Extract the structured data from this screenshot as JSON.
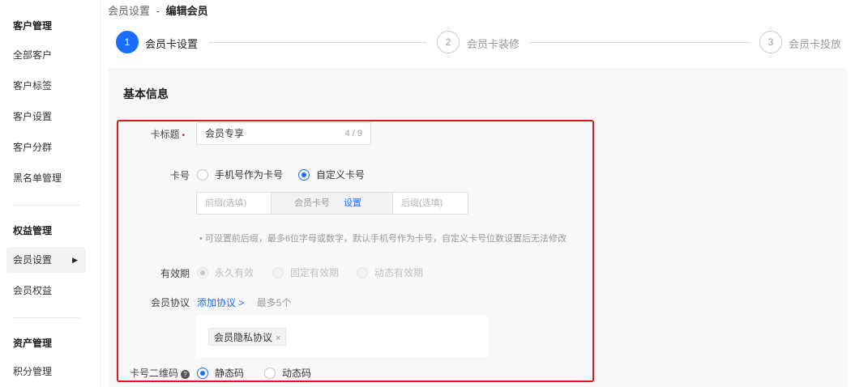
{
  "sidebar": {
    "groups": [
      {
        "title": "客户管理",
        "items": [
          "全部客户",
          "客户标签",
          "客户设置",
          "客户分群",
          "黑名单管理"
        ]
      },
      {
        "title": "权益管理",
        "items": [
          "会员设置",
          "会员权益"
        ]
      },
      {
        "title": "资产管理",
        "items": [
          "积分管理"
        ]
      }
    ],
    "active_item": "会员设置",
    "active_arrow": "▶"
  },
  "breadcrumb": {
    "parent": "会员设置",
    "separator": "-",
    "current": "编辑会员"
  },
  "steps": [
    {
      "num": "1",
      "label": "会员卡设置",
      "active": true
    },
    {
      "num": "2",
      "label": "会员卡装修",
      "active": false
    },
    {
      "num": "3",
      "label": "会员卡投放",
      "active": false
    }
  ],
  "section_title": "基本信息",
  "form": {
    "title_field": {
      "label": "卡标题",
      "required_mark": "•",
      "value": "会员专享",
      "counter": "4 / 9"
    },
    "card_no": {
      "label": "卡号",
      "options": [
        "手机号作为卡号",
        "自定义卡号"
      ],
      "selected": "自定义卡号",
      "prefix_placeholder": "前缀(选填)",
      "middle_label": "会员卡号",
      "middle_link": "设置",
      "suffix_placeholder": "后缀(选填)",
      "hint": "• 可设置前后缀，最多6位字母或数字，默认手机号作为卡号，自定义卡号位数设置后无法修改"
    },
    "validity": {
      "label": "有效期",
      "options": [
        "永久有效",
        "固定有效期",
        "动态有效期"
      ],
      "selected": "永久有效",
      "disabled": true
    },
    "agreement": {
      "label": "会员协议",
      "add_link": "添加协议 >",
      "limit": "最多5个",
      "tags": [
        "会员隐私协议"
      ],
      "tag_close": "×"
    },
    "qrcode": {
      "label": "卡号二维码",
      "help": "?",
      "options": [
        "静态码",
        "动态码"
      ],
      "selected": "静态码"
    }
  },
  "colors": {
    "accent": "#1a6dff",
    "highlight_border": "#e1161c"
  }
}
